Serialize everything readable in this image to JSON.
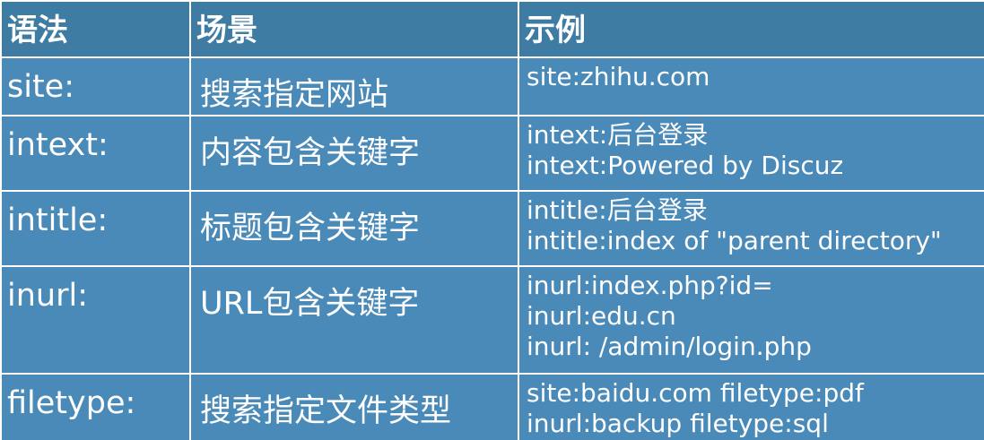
{
  "header": {
    "syntax": "语法",
    "scene": "场景",
    "example": "示例"
  },
  "rows": [
    {
      "syntax": "site:",
      "scene": "搜索指定网站",
      "examples": [
        "site:zhihu.com"
      ]
    },
    {
      "syntax": "intext:",
      "scene": "内容包含关键字",
      "examples": [
        "intext:后台登录",
        "intext:Powered by Discuz"
      ]
    },
    {
      "syntax": "intitle:",
      "scene": "标题包含关键字",
      "examples": [
        "intitle:后台登录",
        "intitle:index of \"parent directory\""
      ]
    },
    {
      "syntax": "inurl:",
      "scene": "URL包含关键字",
      "examples": [
        "inurl:index.php?id=",
        "inurl:edu.cn",
        "inurl: /admin/login.php"
      ]
    },
    {
      "syntax": "filetype:",
      "scene": "搜索指定文件类型",
      "examples": [
        "site:baidu.com filetype:pdf",
        "inurl:backup filetype:sql"
      ]
    }
  ],
  "colors": {
    "header_bg": "#3e7ca4",
    "row_bg": "#4a8ab8",
    "text": "#ffffff",
    "border": "#ffffff"
  }
}
